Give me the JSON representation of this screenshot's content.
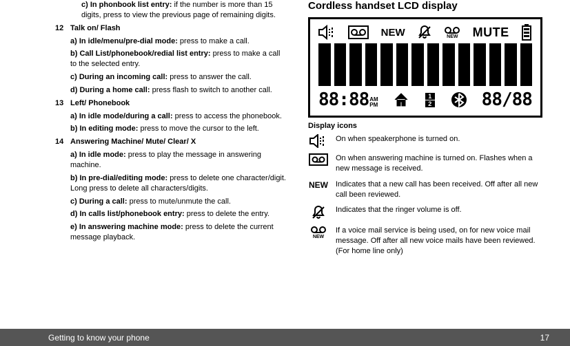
{
  "left": {
    "i11c_lbl": "c) In phonbook list entry:",
    "i11c_txt": " if the number is more than 15 digits, press to view the previous page of remaining digits.",
    "n12": "12",
    "t12": "Talk on/ Flash",
    "i12a_lbl": "a) In idle/menu/pre-dial mode:",
    "i12a_txt": " press to make a call.",
    "i12b_lbl": "b) Call List/phonebook/redial list entry:",
    "i12b_txt": " press to make a call to the selected entry.",
    "i12c_lbl": "c) During an incoming call:",
    "i12c_txt": " press to answer the call.",
    "i12d_lbl": "d) During a home call:",
    "i12d_txt": " press flash to switch to another call.",
    "n13": "13",
    "t13": "Left/ Phonebook",
    "i13a_lbl": "a) In idle mode/during a call:",
    "i13a_txt": " press to access the phonebook.",
    "i13b_lbl": "b) In editing mode:",
    "i13b_txt": " press to move the cursor to the left.",
    "n14": "14",
    "t14": "Answering Machine/ Mute/ Clear/ X",
    "i14a_lbl": "a) In idle mode:",
    "i14a_txt": " press to play the message in answering machine.",
    "i14b_lbl": "b) In pre-dial/editing mode:",
    "i14b_txt": " press to delete one character/digit. Long press to delete all characters/digits.",
    "i14c_lbl": "c) During a call:",
    "i14c_txt": " press to mute/unmute the call.",
    "i14d_lbl": "d) In calls list/phonebook entry:",
    "i14d_txt": " press to delete the entry.",
    "i14e_lbl": "e) In answering machine mode:",
    "i14e_txt": " press to delete the current message playback."
  },
  "right": {
    "heading": "Cordless handset LCD display",
    "lcd_new": "NEW",
    "lcd_mute": "MUTE",
    "lcd_newsmall": "NEW",
    "lcd_time": "88:88",
    "lcd_am": "AM",
    "lcd_pm": "PM",
    "lcd_hs": "2",
    "lcd_date": "88/88",
    "icons_heading": "Display icons",
    "d_speaker": "On when speakerphone is turned on.",
    "d_tape": "On when answering machine is turned on. Flashes when a new message is received.",
    "d_new": "Indicates that a new call has been received. Off after all new call been reviewed.",
    "d_bell": "Indicates that the ringer volume is off.",
    "d_vm": "If a voice mail service is being used, on for new voice mail message. Off after all new voice mails have been reviewed. (For home line only)",
    "newlabel": "NEW",
    "vm_newlabel": "NEW"
  },
  "footer": {
    "left": "Getting to know your phone",
    "right": "17"
  }
}
